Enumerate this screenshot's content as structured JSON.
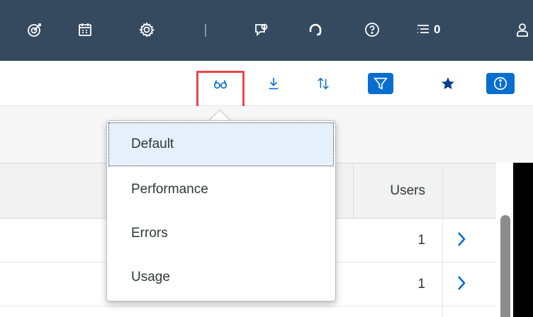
{
  "shellbar": {
    "icons": [
      "target-icon",
      "calendar-icon",
      "gear-icon",
      "feedback-icon",
      "headset-icon",
      "help-icon",
      "notifications-icon",
      "user-icon"
    ],
    "notification_count": "0",
    "colors": {
      "background": "#354a5f",
      "icon": "#ffffff"
    }
  },
  "toolbar": {
    "buttons": [
      "view-glasses-icon",
      "download-icon",
      "sort-icon",
      "filter-icon",
      "star-icon",
      "info-icon"
    ],
    "accent": "#0a6ed1"
  },
  "table": {
    "column_header": "Users",
    "rows": [
      {
        "users": "1"
      },
      {
        "users": "1"
      }
    ]
  },
  "view_menu": {
    "items": [
      {
        "label": "Default",
        "selected": true
      },
      {
        "label": "Performance",
        "selected": false
      },
      {
        "label": "Errors",
        "selected": false
      },
      {
        "label": "Usage",
        "selected": false
      }
    ]
  }
}
